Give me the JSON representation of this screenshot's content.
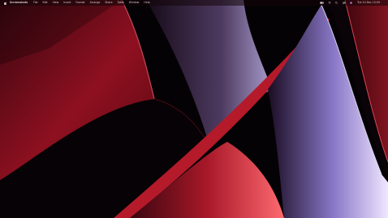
{
  "menubar": {
    "app_name": "Screenshots",
    "menus": [
      {
        "label": "File"
      },
      {
        "label": "Edit"
      },
      {
        "label": "View"
      },
      {
        "label": "Insert"
      },
      {
        "label": "Format"
      },
      {
        "label": "Arrange"
      },
      {
        "label": "Share"
      },
      {
        "label": "Table"
      },
      {
        "label": "Window"
      },
      {
        "label": "Help"
      }
    ],
    "status_icons": [
      "battery-icon",
      "wifi-icon",
      "search-icon",
      "control-center-icon",
      "siri-icon"
    ],
    "clock": "Tue 10 Dec 10:09"
  },
  "wallpaper": {
    "colors": {
      "background": "#050205",
      "crimson": "#9c1020",
      "red_glow": "#e0304a",
      "violet": "#b8a8f0",
      "lavender": "#e8dcff"
    }
  }
}
